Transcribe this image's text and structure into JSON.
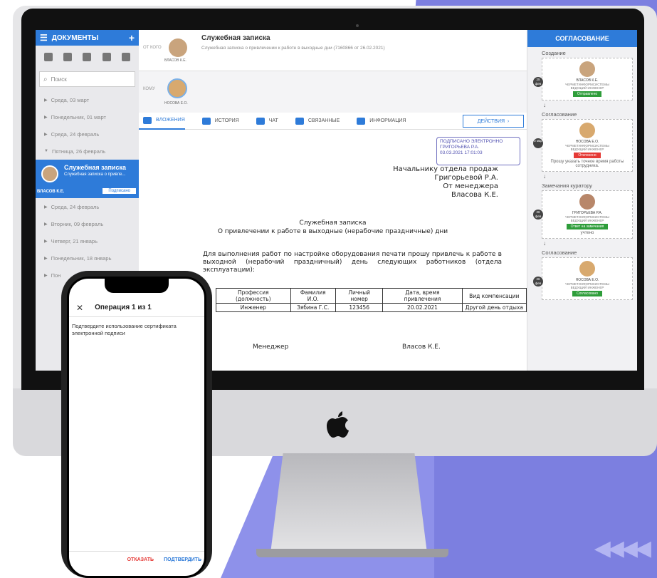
{
  "colors": {
    "accent": "#2e7bd9",
    "green": "#2e9d3a",
    "red": "#e53935",
    "purple": "#7c7fe0"
  },
  "left_panel": {
    "title": "ДОКУМЕНТЫ",
    "search_placeholder": "Поиск",
    "dates_top": [
      "Среда, 03 март",
      "Понедельник, 01 март",
      "Среда, 24 февраль",
      "Пятница, 26 февраль"
    ],
    "active_item": {
      "title": "Служебная записка",
      "subtitle": "Служебная записка о привле...",
      "author": "ВЛАСОВ К.Е.",
      "badge": "Подписано"
    },
    "dates_bottom": [
      "Среда, 24 февраль",
      "Вторник, 09 февраль",
      "Четверг, 21 январь",
      "Понедельник, 18 январь",
      "Пон"
    ]
  },
  "header": {
    "from_label": "ОТ КОГО",
    "from_name": "ВЛАСОВ К.Е.",
    "title": "Служебная записка",
    "subtitle": "Служебная записка о привлечении к работе в выходные дни (7160866 от 26.02.2021)",
    "to_label": "КОМУ",
    "to_name": "НОСОВА Е.О."
  },
  "tabs": [
    "ВЛОЖЕНИЯ",
    "ИСТОРИЯ",
    "ЧАТ",
    "СВЯЗАННЫЕ",
    "ИНФОРМАЦИЯ"
  ],
  "actions_label": "ДЕЙСТВИЯ",
  "document": {
    "stamp": [
      "ПОДПИСАНО ЭЛЕКТРОННО",
      "ГРИГОРЬЕВА Р.А.",
      "03.03.2021 17:01:03"
    ],
    "addr": [
      "Начальнику отдела продаж",
      "Григорьевой Р.А.",
      "От менеджера",
      "Власова К.Е."
    ],
    "heading": "Служебная записка",
    "subheading": "О привлечении к работе в выходные (нерабочие праздничные) дни",
    "paragraph": "Для выполнения работ по настройке оборудования печати прошу привлечь к работе в выходной (нерабочий праздничный) день следующих работников (отдела эксплуатации):",
    "table": {
      "headers": [
        "Профессия (должность)",
        "Фамилия И.О.",
        "Личный номер",
        "Дата, время привлечения",
        "Вид компенсации"
      ],
      "row": [
        "Инженер",
        "Зябина Г.С.",
        "123456",
        "20.02.2021",
        "Другой день отдыха"
      ]
    },
    "sign_role": "Менеджер",
    "sign_name": "Власов К.Е."
  },
  "approval": {
    "title": "СОГЛАСОВАНИЕ",
    "stages": [
      {
        "label": "Создание",
        "date": "25 фев",
        "name": "ВЛАСОВ К.Е.",
        "org": "ЧЕРМЕТИНФОРМСИСТЕМЫ",
        "role": "ВЕДУЩИЙ ИНЖЕНЕР",
        "status": "Отправлено",
        "status_color": "#2e9d3a",
        "note": ""
      },
      {
        "label": "Согласование",
        "date": "3 мар",
        "name": "НОСОВА Е.О.",
        "org": "ЧЕРМЕТИНФОРМСИСТЕМЫ",
        "role": "ВЕДУЩИЙ ИНЖЕНЕР",
        "status": "Отклонено",
        "status_color": "#e53935",
        "note": "Прошу указать точное время работы сотрудника."
      },
      {
        "label": "Замечания куратору",
        "date": "26 фев",
        "name": "ГРИГОРЬЕВА Р.А.",
        "org": "ЧЕРМЕТИНФОРМСИСТЕМЫ",
        "role": "ВЕДУЩИЙ ИНЖЕНЕР",
        "status": "Ответ на замечания",
        "status_color": "#2e9d3a",
        "note": "учтено"
      },
      {
        "label": "Согласование",
        "date": "26 фев",
        "name": "НОСОВА Е.О.",
        "org": "ЧЕРМЕТИНФОРМСИСТЕМЫ",
        "role": "ВЕДУЩИЙ ИНЖЕНЕР",
        "status": "Согласовано",
        "status_color": "#2e9d3a",
        "note": ""
      }
    ]
  },
  "phone": {
    "title": "Операция 1 из 1",
    "message": "Подтвердите использование сертификата электронной подписи",
    "reject": "ОТКАЗАТЬ",
    "confirm": "ПОДТВЕРДИТЬ"
  }
}
